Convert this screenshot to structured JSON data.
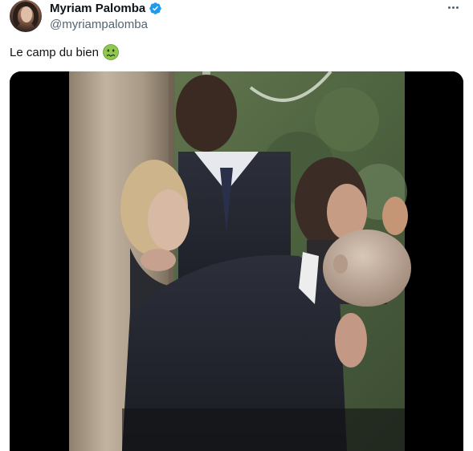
{
  "author": {
    "display_name": "Myriam Palomba",
    "handle": "@myriampalomba",
    "verified": true
  },
  "tweet": {
    "text": "Le camp du bien",
    "emoji": "nauseated-face-emoji"
  },
  "icons": {
    "more": "more-options-icon",
    "verified": "verified-badge-icon"
  },
  "colors": {
    "verified_blue": "#1d9bf0",
    "secondary_text": "#536471",
    "primary_text": "#0f1419"
  }
}
